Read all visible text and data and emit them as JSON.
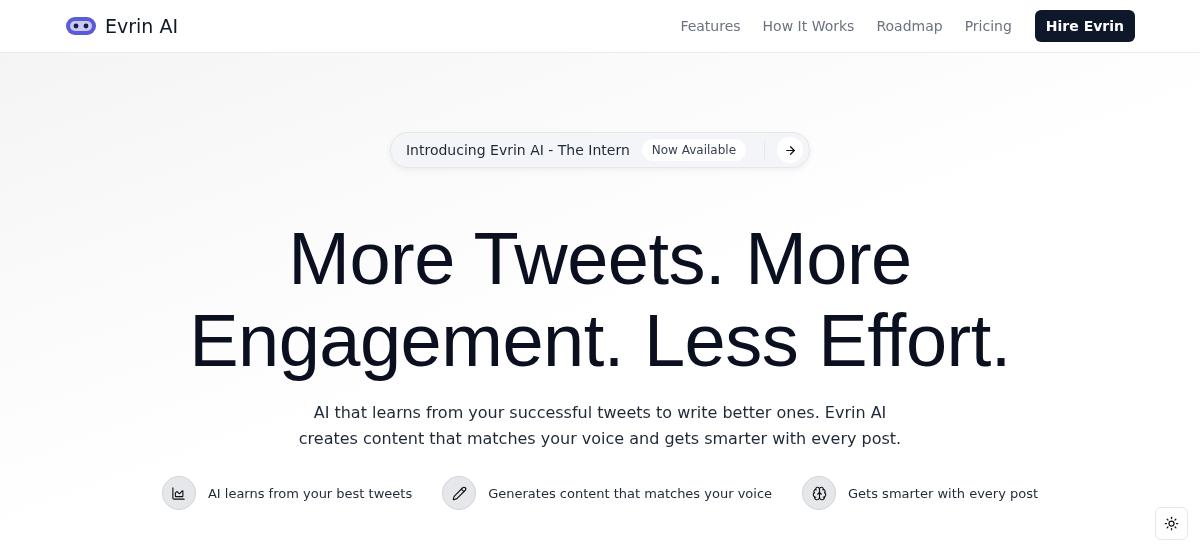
{
  "brand": {
    "name": "Evrin AI"
  },
  "nav": {
    "links": [
      "Features",
      "How It Works",
      "Roadmap",
      "Pricing"
    ],
    "cta": "Hire Evrin"
  },
  "announcement": {
    "text": "Introducing Evrin AI - The Intern",
    "badge": "Now Available"
  },
  "hero": {
    "headline": "More Tweets. More Engagement. Less Effort.",
    "subtitle": "AI that learns from your successful tweets to write better ones. Evrin AI creates content that matches your voice and gets smarter with every post."
  },
  "features": [
    {
      "kind": "chart",
      "text": "AI learns from your best tweets"
    },
    {
      "kind": "pencil",
      "text": "Generates content that matches your voice"
    },
    {
      "kind": "brain",
      "text": "Gets smarter with every post"
    }
  ]
}
